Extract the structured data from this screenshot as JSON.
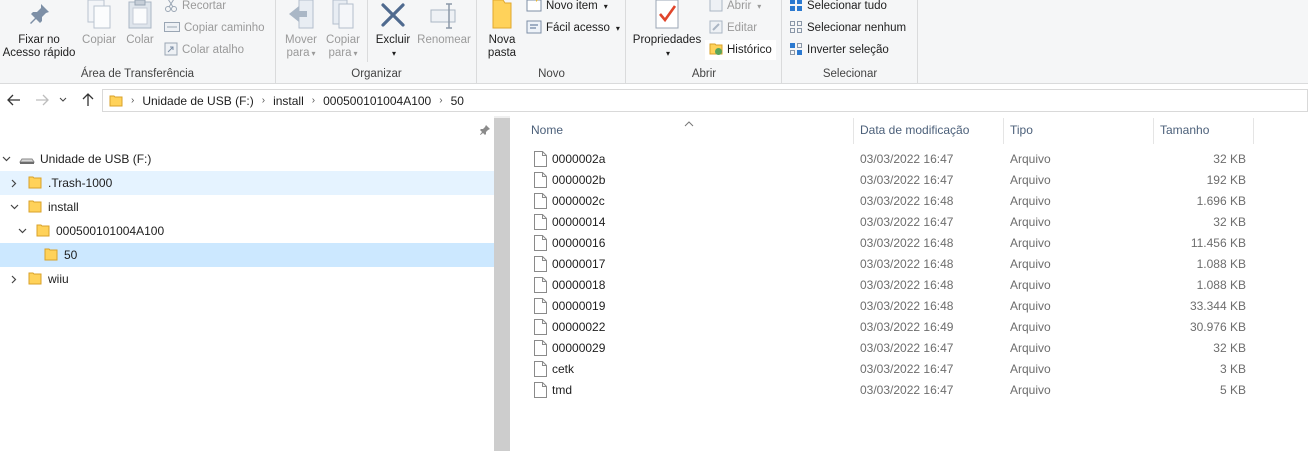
{
  "ribbon": {
    "clipboard": {
      "pin_label_1": "Fixar no",
      "pin_label_2": "Acesso rápido",
      "copy_label": "Copiar",
      "paste_label": "Colar",
      "cut_label": "Recortar",
      "copy_path_label": "Copiar caminho",
      "paste_shortcut_label": "Colar atalho",
      "group_label": "Área de Transferência"
    },
    "organize": {
      "move_label_1": "Mover",
      "move_label_2": "para",
      "copyto_label_1": "Copiar",
      "copyto_label_2": "para",
      "delete_label": "Excluir",
      "rename_label": "Renomear",
      "group_label": "Organizar"
    },
    "new": {
      "new_folder_label_1": "Nova",
      "new_folder_label_2": "pasta",
      "new_item_label": "Novo item",
      "easy_access_label": "Fácil acesso",
      "group_label": "Novo"
    },
    "open": {
      "properties_label": "Propriedades",
      "open_label": "Abrir",
      "edit_label": "Editar",
      "history_label": "Histórico",
      "group_label": "Abrir"
    },
    "select": {
      "select_all_label": "Selecionar tudo",
      "select_none_label": "Selecionar nenhum",
      "invert_label": "Inverter seleção",
      "group_label": "Selecionar"
    }
  },
  "address": {
    "crumbs": [
      "Unidade de USB (F:)",
      "install",
      "000500101004A100",
      "50"
    ]
  },
  "tree": {
    "items": [
      {
        "label": "Unidade de USB (F:)"
      },
      {
        "label": ".Trash-1000"
      },
      {
        "label": "install"
      },
      {
        "label": "000500101004A100"
      },
      {
        "label": "50"
      },
      {
        "label": "wiiu"
      }
    ]
  },
  "columns": {
    "name": "Nome",
    "modified": "Data de modificação",
    "type": "Tipo",
    "size": "Tamanho"
  },
  "files": [
    {
      "name": "0000002a",
      "modified": "03/03/2022 16:47",
      "type": "Arquivo",
      "size": "32 KB"
    },
    {
      "name": "0000002b",
      "modified": "03/03/2022 16:47",
      "type": "Arquivo",
      "size": "192 KB"
    },
    {
      "name": "0000002c",
      "modified": "03/03/2022 16:48",
      "type": "Arquivo",
      "size": "1.696 KB"
    },
    {
      "name": "00000014",
      "modified": "03/03/2022 16:47",
      "type": "Arquivo",
      "size": "32 KB"
    },
    {
      "name": "00000016",
      "modified": "03/03/2022 16:48",
      "type": "Arquivo",
      "size": "11.456 KB"
    },
    {
      "name": "00000017",
      "modified": "03/03/2022 16:48",
      "type": "Arquivo",
      "size": "1.088 KB"
    },
    {
      "name": "00000018",
      "modified": "03/03/2022 16:48",
      "type": "Arquivo",
      "size": "1.088 KB"
    },
    {
      "name": "00000019",
      "modified": "03/03/2022 16:48",
      "type": "Arquivo",
      "size": "33.344 KB"
    },
    {
      "name": "00000022",
      "modified": "03/03/2022 16:49",
      "type": "Arquivo",
      "size": "30.976 KB"
    },
    {
      "name": "00000029",
      "modified": "03/03/2022 16:47",
      "type": "Arquivo",
      "size": "32 KB"
    },
    {
      "name": "cetk",
      "modified": "03/03/2022 16:47",
      "type": "Arquivo",
      "size": "3 KB"
    },
    {
      "name": "tmd",
      "modified": "03/03/2022 16:47",
      "type": "Arquivo",
      "size": "5 KB"
    }
  ],
  "colors": {
    "ribbon_bg": "#f5f6f7",
    "selected_bg": "#cce8ff",
    "hover_bg": "#e5f3ff",
    "folder_yellow": "#ffd25a",
    "header_text": "#4c607a"
  }
}
